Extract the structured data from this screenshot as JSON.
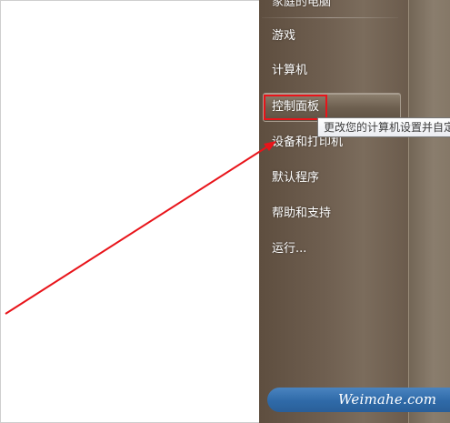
{
  "start_menu": {
    "items": [
      {
        "label": "家庭的电脑",
        "partial": true
      },
      {
        "label": "游戏"
      },
      {
        "label": "计算机"
      },
      {
        "label": "控制面板",
        "highlighted": true
      },
      {
        "label": "设备和打印机"
      },
      {
        "label": "默认程序"
      },
      {
        "label": "帮助和支持"
      },
      {
        "label": "运行..."
      }
    ]
  },
  "tooltip": {
    "text": "更改您的计算机设置并自定"
  },
  "watermark": {
    "text": "Weimahe.com"
  },
  "colors": {
    "annotation_red": "#e8141a",
    "panel_brown": "#6f5f50",
    "banner_blue": "#2f6aa8"
  }
}
